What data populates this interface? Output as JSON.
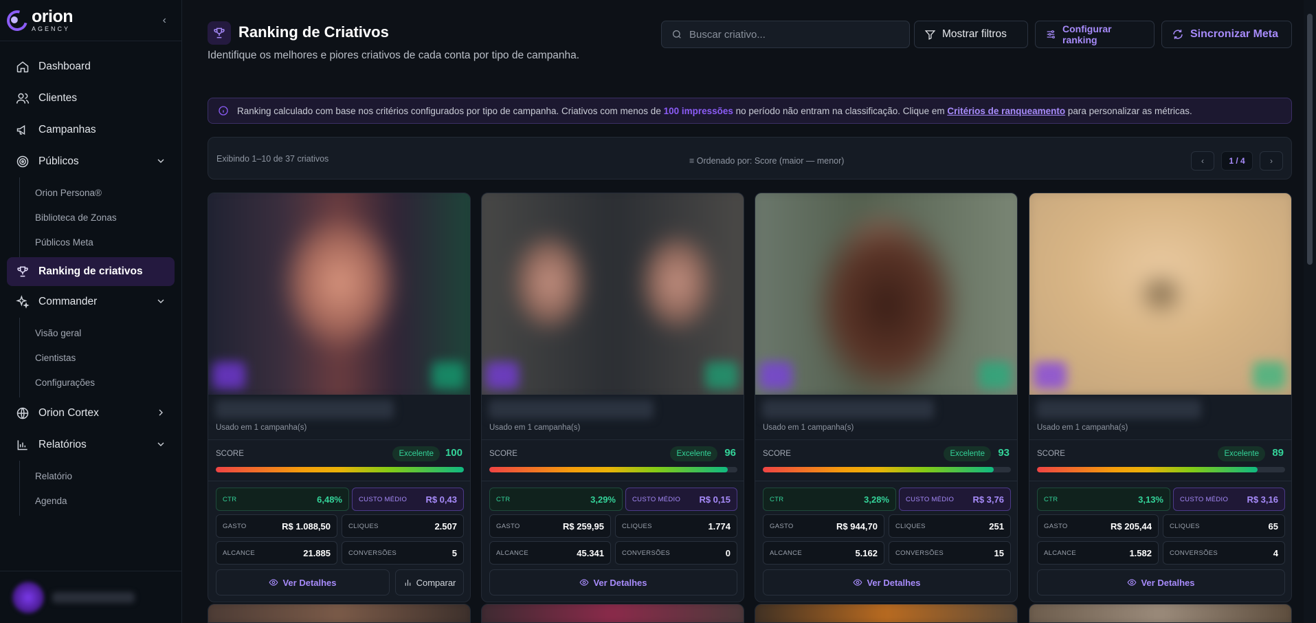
{
  "brand": {
    "name": "orion",
    "sub": "AGENCY"
  },
  "sidebar": {
    "items": [
      {
        "label": "Dashboard"
      },
      {
        "label": "Clientes"
      },
      {
        "label": "Campanhas"
      },
      {
        "label": "Públicos"
      },
      {
        "label": "Ranking de criativos"
      },
      {
        "label": "Commander"
      },
      {
        "label": "Orion Cortex"
      },
      {
        "label": "Relatórios"
      }
    ],
    "publicos_sub": [
      "Orion Persona®",
      "Biblioteca de Zonas",
      "Públicos Meta"
    ],
    "commander_sub": [
      "Visão geral",
      "Cientistas",
      "Configurações"
    ],
    "relatorios_sub": [
      "Relatório",
      "Agenda"
    ]
  },
  "header": {
    "title": "Ranking de Criativos",
    "subtitle": "Identifique os melhores e piores criativos de cada conta por tipo de campanha.",
    "search_placeholder": "Buscar criativo...",
    "filter_label": "Mostrar filtros",
    "config_label": "Configurar ranking",
    "sync_label": "Sincronizar Meta"
  },
  "info": {
    "part1": "Ranking calculado com base nos critérios configurados por tipo de campanha. Criativos com menos de ",
    "highlight": "100 impressões",
    "part2": " no período não entram na classificação. Clique em ",
    "link": "Critérios de ranqueamento",
    "part3": " para personalizar as métricas."
  },
  "list": {
    "count": "Exibindo 1–10 de 37 criativos",
    "order": "≡ Ordenado por: Score (maior — menor)",
    "prev": "‹",
    "page": "1 / 4",
    "next": "›"
  },
  "labels": {
    "used": "Usado em 1 campanha(s)",
    "score": "SCORE",
    "ctr": "CTR",
    "custo": "CUSTO MÉDIO",
    "gasto": "GASTO",
    "cliques": "CLIQUES",
    "alcance": "ALCANCE",
    "conversoes": "CONVERSÕES",
    "details": "Ver Detalhes",
    "compare": "Comparar"
  },
  "cards": [
    {
      "badge": "Excelente",
      "score": "100",
      "score_fraction": 1.0,
      "ctr": "6,48%",
      "custo": "R$ 0,43",
      "gasto": "R$ 1.088,50",
      "cliques": "2.507",
      "alcance": "21.885",
      "conversoes": "5"
    },
    {
      "badge": "Excelente",
      "score": "96",
      "score_fraction": 0.96,
      "ctr": "3,29%",
      "custo": "R$ 0,15",
      "gasto": "R$ 259,95",
      "cliques": "1.774",
      "alcance": "45.341",
      "conversoes": "0"
    },
    {
      "badge": "Excelente",
      "score": "93",
      "score_fraction": 0.93,
      "ctr": "3,28%",
      "custo": "R$ 3,76",
      "gasto": "R$ 944,70",
      "cliques": "251",
      "alcance": "5.162",
      "conversoes": "15"
    },
    {
      "badge": "Excelente",
      "score": "89",
      "score_fraction": 0.89,
      "ctr": "3,13%",
      "custo": "R$ 3,16",
      "gasto": "R$ 205,44",
      "cliques": "65",
      "alcance": "1.582",
      "conversoes": "4"
    }
  ]
}
